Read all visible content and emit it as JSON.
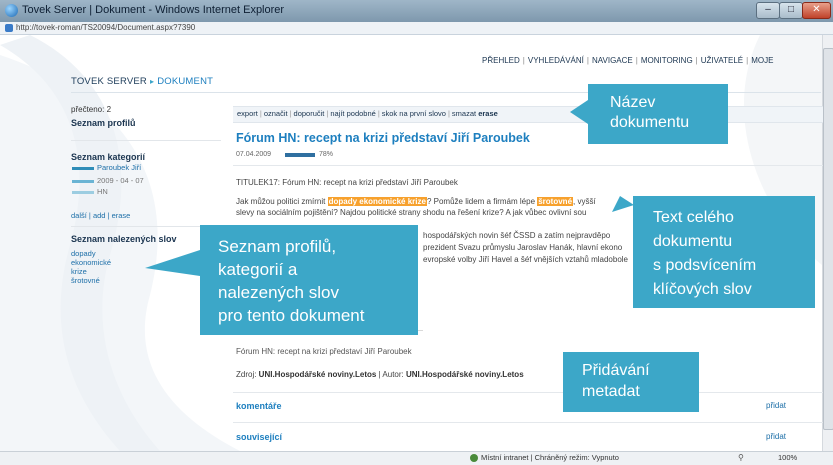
{
  "window": {
    "title": "Tovek Server | Dokument - Windows Internet Explorer"
  },
  "browser": {
    "url": "http://tovek-roman/TS20094/Document.aspx?7390"
  },
  "page": {
    "nav": [
      "PŘEHLED",
      "VYHLEDÁVÁNÍ",
      "NAVIGACE",
      "MONITORING",
      "UŽIVATELÉ",
      "MOJE"
    ],
    "brand": {
      "server": "TOVEK SERVER",
      "section": "DOKUMENT"
    }
  },
  "sidebar": {
    "read_count": "přečteno: 2",
    "profiles_heading": "Seznam profilů",
    "categories_heading": "Seznam kategorií",
    "categories": [
      {
        "name": "Paroubek Jiří",
        "date": "2009 - 04 - 07",
        "tag": "HN"
      }
    ],
    "category_links": "další | add | erase",
    "found_words_heading": "Seznam nalezených slov",
    "found_words": [
      "dopady",
      "ekonomické",
      "krize",
      "šrotovné"
    ]
  },
  "main": {
    "toolbar": [
      "export",
      "označit",
      "doporučit",
      "najít podobné",
      "skok na první slovo",
      "smazat"
    ],
    "toolbar_extra": "erase",
    "title": "Fórum HN: recept na krizi představí Jiří Paroubek",
    "date": "07.04.2009",
    "relevance": "78%",
    "relevance_value": 0.78,
    "body_title": "TITULEK17: Fórum HN: recept na krizi představí Jiří Paroubek",
    "body_line1": {
      "before": "Jak můžou politici zmírnit ",
      "highlight1": "dopady ekonomické krize",
      "middle": "? Pomůže lidem a firmám lépe ",
      "highlight2": "šrotovné",
      "after": ", vyšší"
    },
    "body_line2": "slevy na sociálním pojištění? Najdou politické strany shodu na řešení krize? A jak vůbec ovlivní sou",
    "body_line3": "hospodářských novin šéf ČSSD a zatím nejpravděpo",
    "body_line4": "prezident Svazu průmyslu Jaroslav Hanák, hlavní ekono",
    "body_line5": "evropské volby Jiří Havel a šéf vnějších vztahů mladobole",
    "body_repeat": "Fórum HN: recept na krizi představí Jiří Paroubek",
    "source_label": "Zdroj: ",
    "source_value": "UNI.Hospodářské noviny.Letos",
    "author_label": " | Autor: ",
    "author_value": "UNI.Hospodářské noviny.Letos",
    "sections": [
      {
        "heading": "komentáře",
        "action": "přidat"
      },
      {
        "heading": "související",
        "action": "přidat"
      }
    ]
  },
  "callouts": {
    "title": [
      "Název",
      "dokumentu"
    ],
    "fulltext": [
      "Text celého",
      "dokumentu",
      "s podsvícením",
      "klíčových slov"
    ],
    "lists": [
      "Seznam profilů,",
      "kategorií a",
      "nalezených slov",
      "pro tento dokument"
    ],
    "metadata": [
      "Přidávání",
      "metadat"
    ]
  },
  "statusbar": {
    "zone": "Místní intranet | Chráněný režim: Vypnuto",
    "zoom": "100%"
  },
  "colors": {
    "accent": "#3ca7c8",
    "link": "#1d7fbf",
    "highlight": "#f7a12d"
  }
}
